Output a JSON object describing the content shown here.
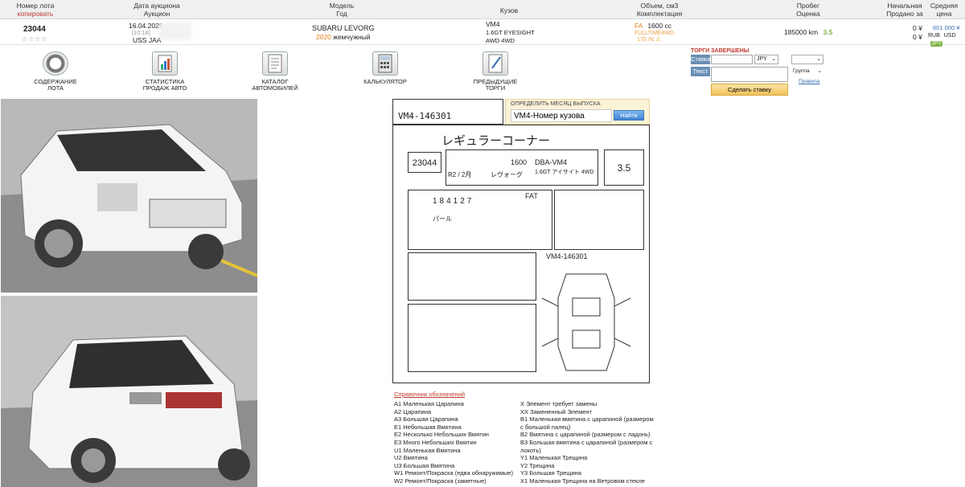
{
  "header": {
    "lot_label": "Номер лота",
    "copy_label": "копировать",
    "date_label": "Дата аукциона",
    "auction_label": "Аукцион",
    "model_label": "Модель",
    "year_label": "Год",
    "body_label": "Кузов",
    "volume_label": "Объем, см3",
    "grade_label": "Комплектация",
    "mileage_label": "Пробег",
    "rating_label": "Оценка",
    "start_label": "Начальная",
    "sold_label": "Продано за",
    "avg_label": "Средняя",
    "price_label": "цена"
  },
  "lot": {
    "number": "23044",
    "stars": "☆☆☆☆",
    "date": "16.04.2025",
    "time": "[10:18]",
    "auction": "USS JAA",
    "model": "SUBARU LEVORG",
    "year": "2020",
    "color": "жемчужный",
    "body_code": "VM4",
    "grade": "1.6GT EYESIGHT",
    "drive": "AWD 4WD",
    "engine_code": "FA",
    "volume": "1600 cc",
    "fuel": "FULLTIME4WD",
    "power": "170 Лс",
    "mileage": "185000 km",
    "rating": "3.5",
    "start_price": "0 ¥",
    "sold_price": "0 ¥",
    "avg_price": "601 000 ¥",
    "currencies": [
      "RUB",
      "USD",
      "JPY"
    ]
  },
  "menu": [
    {
      "line1": "Содержание",
      "line2": "лота",
      "icon": "steering-wheel-icon"
    },
    {
      "line1": "Статистика",
      "line2": "продаж авто",
      "icon": "statistics-icon"
    },
    {
      "line1": "Каталог",
      "line2": "автомобилей",
      "icon": "catalog-icon"
    },
    {
      "line1": "Калькулятор",
      "line2": "",
      "icon": "calculator-icon"
    },
    {
      "line1": "Предыдущие",
      "line2": "торги",
      "icon": "previous-bids-icon"
    }
  ],
  "bid": {
    "title": "ТОРГИ ЗАВЕРШЕНЫ",
    "stake_label": "Ставка",
    "text_label": "Текст",
    "currency": "JPY",
    "group": "Группа",
    "rules": "Правила",
    "submit": "Сделать ставку"
  },
  "decode": {
    "title": "ОПРЕДЕЛИТЬ МЕСЯЦ ВЫПУСКА",
    "value": "VM4-Номер кузова",
    "button": "Найти"
  },
  "sheet": {
    "chassis": "VM4-146301",
    "title": "レギュラーコーナー",
    "lot": "23044",
    "grade_jp": "1.6GT アイサイト 4WD",
    "model_code": "DBA-VM4",
    "cc": "1600",
    "year": "R2 / 2月",
    "name": "レヴォーグ",
    "mileage": "184127",
    "score": "3.5",
    "color_jp": "パール",
    "shift": "FAT"
  },
  "legend": {
    "title": "Справочник обозначений",
    "left": [
      "A1 Маленькая Царапина",
      "A2 Царапина",
      "A3 Большая Царапина",
      "E1 Небольшая Вмятина",
      "E2 Несколько Небольших Вмятин",
      "E3 Много Небольших Вмятин",
      "U1 Маленькая Вмятина",
      "U2 Вмятина",
      "U3 Большая Вмятина",
      "W1 Ремонт/Покраска (едва обнаружимые)",
      "W2 Ремонт/Покраска (заметные)"
    ],
    "right": [
      "X Элемент требует замены",
      "XX Замененный Элемент",
      "B1 Маленькая вмятина с царапиной (размером",
      "с большой палец)",
      "B2 Вмятина с царапиной (размером с ладонь)",
      "B3 Большая вмятина с царапиной (размером с",
      "локоть)",
      "Y1 Маленькая Трещина",
      "Y2 Трещина",
      "Y3 Большая Трещина",
      "X1 Маленькая Трещина на Ветровом стекле"
    ]
  }
}
